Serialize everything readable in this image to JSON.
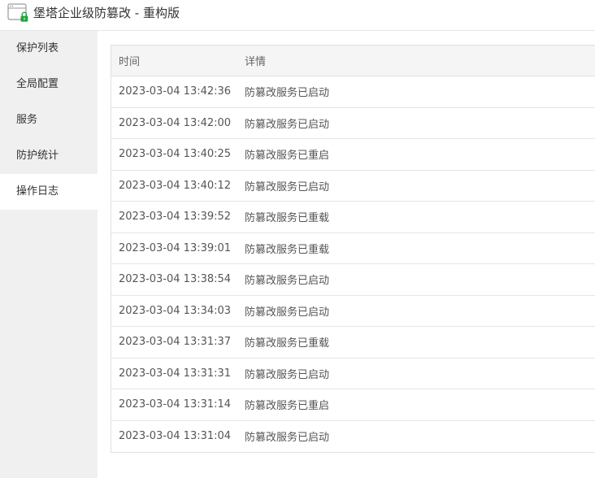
{
  "window": {
    "title": "堡塔企业级防篡改 - 重构版",
    "icon": "app-window-lock-icon"
  },
  "colors": {
    "lock_accent": "#20a53a",
    "sidebar_bg": "#f0f0f0",
    "header_bg": "#f5f5f5"
  },
  "sidebar": {
    "items": [
      {
        "label": "保护列表",
        "active": false
      },
      {
        "label": "全局配置",
        "active": false
      },
      {
        "label": "服务",
        "active": false
      },
      {
        "label": "防护统计",
        "active": false
      },
      {
        "label": "操作日志",
        "active": true
      }
    ]
  },
  "log_table": {
    "headers": {
      "time": "时间",
      "detail": "详情"
    },
    "rows": [
      {
        "time": "2023-03-04 13:42:36",
        "detail": "防篡改服务已启动"
      },
      {
        "time": "2023-03-04 13:42:00",
        "detail": "防篡改服务已启动"
      },
      {
        "time": "2023-03-04 13:40:25",
        "detail": "防篡改服务已重启"
      },
      {
        "time": "2023-03-04 13:40:12",
        "detail": "防篡改服务已启动"
      },
      {
        "time": "2023-03-04 13:39:52",
        "detail": "防篡改服务已重载"
      },
      {
        "time": "2023-03-04 13:39:01",
        "detail": "防篡改服务已重载"
      },
      {
        "time": "2023-03-04 13:38:54",
        "detail": "防篡改服务已启动"
      },
      {
        "time": "2023-03-04 13:34:03",
        "detail": "防篡改服务已启动"
      },
      {
        "time": "2023-03-04 13:31:37",
        "detail": "防篡改服务已重载"
      },
      {
        "time": "2023-03-04 13:31:31",
        "detail": "防篡改服务已启动"
      },
      {
        "time": "2023-03-04 13:31:14",
        "detail": "防篡改服务已重启"
      },
      {
        "time": "2023-03-04 13:31:04",
        "detail": "防篡改服务已启动"
      }
    ]
  }
}
